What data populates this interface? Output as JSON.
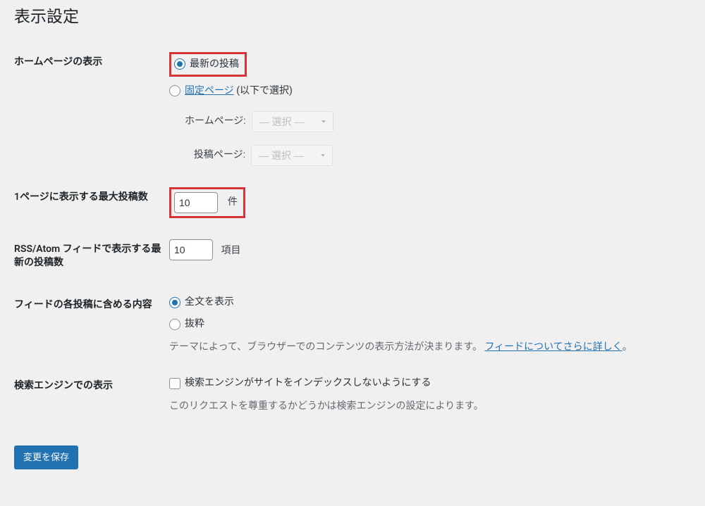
{
  "page": {
    "title": "表示設定"
  },
  "homepage": {
    "heading": "ホームページの表示",
    "opt_latest": "最新の投稿",
    "opt_static_link": "固定ページ",
    "opt_static_suffix": " (以下で選択)",
    "sub_home_label": "ホームページ:",
    "sub_posts_label": "投稿ページ:",
    "select_placeholder": "— 選択 —"
  },
  "posts_per_page": {
    "heading": "1ページに表示する最大投稿数",
    "value": "10",
    "unit": "件"
  },
  "rss": {
    "heading": "RSS/Atom フィードで表示する最新の投稿数",
    "value": "10",
    "unit": "項目"
  },
  "feed_content": {
    "heading": "フィードの各投稿に含める内容",
    "opt_full": "全文を表示",
    "opt_excerpt": "抜粋",
    "desc_pre": "テーマによって、ブラウザーでのコンテンツの表示方法が決まります。",
    "desc_link": "フィードについてさらに詳しく",
    "desc_post": "。"
  },
  "search_engine": {
    "heading": "検索エンジンでの表示",
    "checkbox_label": "検索エンジンがサイトをインデックスしないようにする",
    "desc": "このリクエストを尊重するかどうかは検索エンジンの設定によります。"
  },
  "submit": {
    "label": "変更を保存"
  }
}
